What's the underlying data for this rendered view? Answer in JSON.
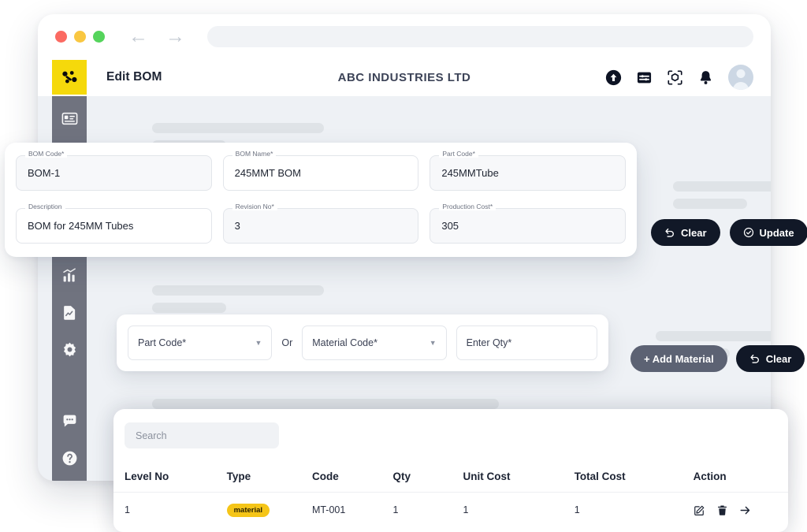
{
  "browser": {
    "traffic_lights": [
      "close",
      "minimize",
      "maximize"
    ],
    "back_arrow": "←",
    "forward_arrow": "→",
    "url_value": ""
  },
  "header": {
    "logo_name": "network-nodes-logo",
    "page_title": "Edit BOM",
    "company": "ABC INDUSTRIES LTD",
    "icons": [
      "upload-circle-icon",
      "filter-sliders-icon",
      "scan-box-icon",
      "bell-icon"
    ],
    "avatar": "user-avatar"
  },
  "sidebar": {
    "items": [
      {
        "icon": "id-card-icon"
      },
      {
        "icon": "calendar-icon"
      },
      {
        "icon": "image-settings-icon"
      },
      {
        "icon": "bar-chart-icon"
      },
      {
        "icon": "report-document-icon"
      },
      {
        "icon": "gear-icon"
      },
      {
        "icon": "chat-bubble-icon"
      },
      {
        "icon": "help-circle-icon"
      }
    ]
  },
  "form": {
    "fields": [
      {
        "label": "BOM Code*",
        "value": "BOM-1"
      },
      {
        "label": "BOM Name*",
        "value": "245MMT BOM"
      },
      {
        "label": "Part Code*",
        "value": "245MMTube"
      },
      {
        "label": "Description",
        "value": "BOM for 245MM Tubes"
      },
      {
        "label": "Revision No*",
        "value": "3"
      },
      {
        "label": "Production Cost*",
        "value": "305"
      }
    ],
    "buttons": [
      {
        "label": "Clear",
        "icon": "undo-icon",
        "style": "dark"
      },
      {
        "label": "Update",
        "icon": "check-circle-icon",
        "style": "dark"
      }
    ]
  },
  "picker": {
    "part_code_placeholder": "Part Code*",
    "or_label": "Or",
    "material_code_placeholder": "Material Code*",
    "qty_placeholder": "Enter Qty*",
    "buttons": [
      {
        "label": "+ Add Material",
        "icon": "",
        "style": "gray"
      },
      {
        "label": "Clear",
        "icon": "undo-icon",
        "style": "dark"
      }
    ]
  },
  "table": {
    "search_placeholder": "Search",
    "columns": [
      "Level No",
      "Type",
      "Code",
      "Qty",
      "Unit Cost",
      "Total Cost",
      "Action"
    ],
    "rows": [
      {
        "level_no": "1",
        "type": "material",
        "code": "MT-001",
        "qty": "1",
        "unit_cost": "1",
        "total_cost": "1",
        "actions": [
          "edit-icon",
          "delete-icon",
          "arrow-right-icon"
        ]
      }
    ]
  },
  "colors": {
    "brand_yellow": "#F5D90B",
    "badge_yellow": "#F5C518",
    "dark_button": "#111827",
    "gray_button": "#5C6273",
    "sidebar": "#70737F",
    "page_bg": "#EEF1F5"
  }
}
